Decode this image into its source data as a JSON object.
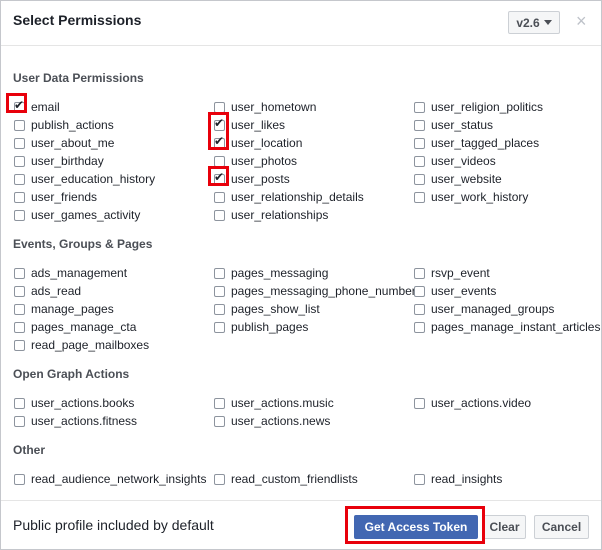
{
  "dialog": {
    "title": "Select Permissions",
    "version_label": "v2.6",
    "close_glyph": "×"
  },
  "sections": {
    "user_data": {
      "title": "User Data Permissions",
      "col1": [
        "email",
        "publish_actions",
        "user_about_me",
        "user_birthday",
        "user_education_history",
        "user_friends",
        "user_games_activity"
      ],
      "col2": [
        "user_hometown",
        "user_likes",
        "user_location",
        "user_photos",
        "user_posts",
        "user_relationship_details",
        "user_relationships"
      ],
      "col3": [
        "user_religion_politics",
        "user_status",
        "user_tagged_places",
        "user_videos",
        "user_website",
        "user_work_history"
      ]
    },
    "events": {
      "title": "Events, Groups & Pages",
      "col1": [
        "ads_management",
        "ads_read",
        "manage_pages",
        "pages_manage_cta",
        "read_page_mailboxes"
      ],
      "col2": [
        "pages_messaging",
        "pages_messaging_phone_number",
        "pages_show_list",
        "publish_pages"
      ],
      "col3": [
        "rsvp_event",
        "user_events",
        "user_managed_groups",
        "pages_manage_instant_articles"
      ]
    },
    "open_graph": {
      "title": "Open Graph Actions",
      "col1": [
        "user_actions.books",
        "user_actions.fitness"
      ],
      "col2": [
        "user_actions.music",
        "user_actions.news"
      ],
      "col3": [
        "user_actions.video"
      ]
    },
    "other": {
      "title": "Other",
      "col1": [
        "read_audience_network_insights"
      ],
      "col2": [
        "read_custom_friendlists"
      ],
      "col3": [
        "read_insights"
      ]
    }
  },
  "checked": [
    "email",
    "user_likes",
    "user_location",
    "user_posts"
  ],
  "highlight_color": "#e8000b",
  "footer": {
    "note": "Public profile included by default",
    "get_token_label": "Get Access Token",
    "clear_label": "Clear",
    "cancel_label": "Cancel"
  },
  "colors": {
    "primary": "#4267b2",
    "border": "#ccd0d5"
  }
}
